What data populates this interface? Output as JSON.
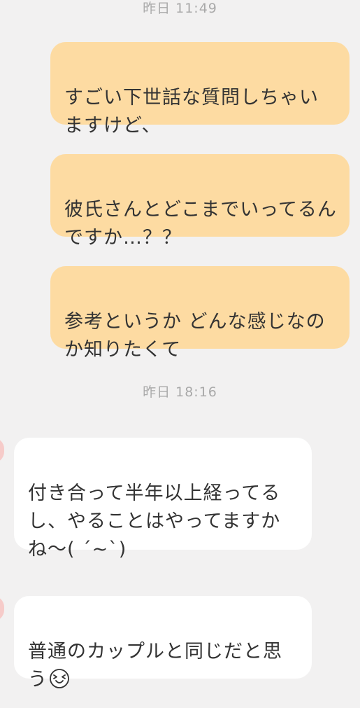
{
  "chat": {
    "timestamps": [
      "昨日  11:49",
      "昨日  18:16"
    ],
    "sent_messages": [
      "すごい下世話な質問しちゃいますけど、",
      "彼氏さんとどこまでいってるんですか…？？",
      "参考というか どんな感じなのか知りたくて"
    ],
    "received_messages": [
      "付き合って半年以上経ってるし、やることはやってますかね〜( ´~`)",
      "普通のカップルと同じだと思う"
    ],
    "received_message_emoji": "grinning-squint-face-icon"
  },
  "colors": {
    "background": "#f2f1f1",
    "sent_bubble": "#fddba2",
    "received_bubble": "#ffffff",
    "timestamp_text": "#a9a9a9",
    "message_text": "#333333",
    "avatar_hint": "#f6c7c4"
  }
}
